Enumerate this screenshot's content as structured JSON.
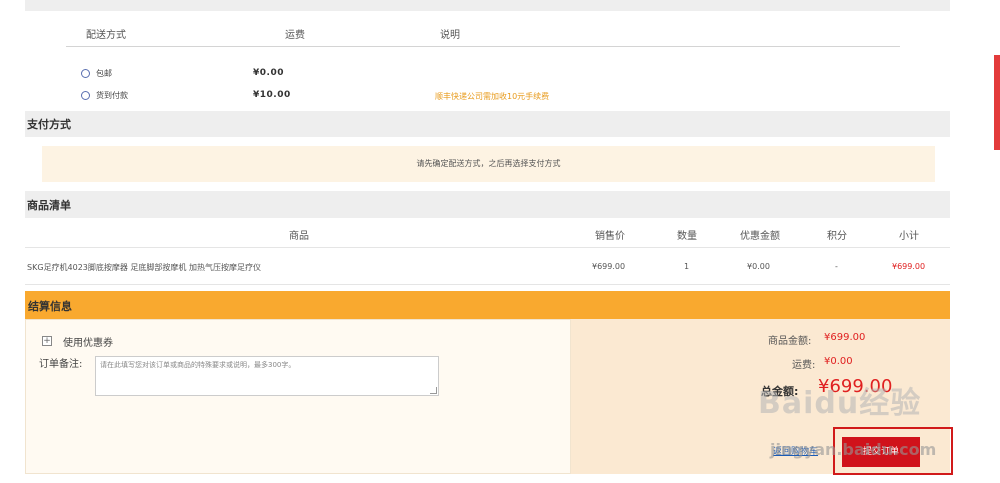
{
  "shipping": {
    "columns": [
      "配送方式",
      "运费",
      "说明"
    ],
    "options": [
      {
        "label": "包邮",
        "fee": "¥0.00",
        "note": ""
      },
      {
        "label": "货到付款",
        "fee": "¥10.00",
        "note": "顺丰快递公司需加收10元手续费"
      }
    ]
  },
  "payment": {
    "title": "支付方式",
    "note": "请先确定配送方式，之后再选择支付方式"
  },
  "goods": {
    "title": "商品清单",
    "headers": [
      "商品",
      "销售价",
      "数量",
      "优惠金额",
      "积分",
      "小计"
    ],
    "rows": [
      {
        "name": "SKG足疗机4023脚底按摩器 足底脚部按摩机 加热气压按摩足疗仪",
        "price": "¥699.00",
        "qty": "1",
        "discount": "¥0.00",
        "points": "-",
        "subtotal": "¥699.00"
      }
    ]
  },
  "settlement": {
    "title": "结算信息",
    "coupon_label": "使用优惠券",
    "remark_label": "订单备注:",
    "remark_placeholder": "请在此填写您对该订单或商品的特殊要求或说明，最多300字。",
    "goods_amount_label": "商品金额:",
    "goods_amount": "¥699.00",
    "shipping_label": "运费:",
    "shipping_amount": "¥0.00",
    "total_label": "总金额:",
    "total_amount": "¥699.00",
    "back_link": "返回购物车",
    "submit_label": "提交订单"
  },
  "watermark": {
    "text": "Baidu经验",
    "sub": "jingyan.baidu.com"
  },
  "colors": {
    "accent": "#f9a92f",
    "price": "#e02020",
    "submit": "#d0121b",
    "note": "#e89b1c"
  }
}
